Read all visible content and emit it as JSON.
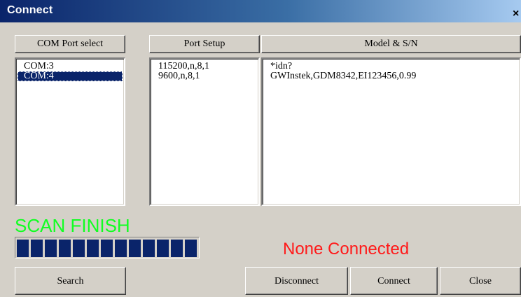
{
  "window": {
    "title": "Connect",
    "close_glyph": "×"
  },
  "columns": {
    "com_port": {
      "header": "COM Port select",
      "items": [
        {
          "label": "COM:3",
          "selected": false
        },
        {
          "label": "COM:4",
          "selected": true
        }
      ]
    },
    "port_setup": {
      "header": "Port Setup",
      "items": [
        "115200,n,8,1",
        "9600,n,8,1"
      ]
    },
    "model_sn": {
      "header": "Model & S/N",
      "lines": [
        "*idn?",
        "GWInstek,GDM8342,EI123456,0.99"
      ]
    }
  },
  "scan": {
    "status": "SCAN FINISH",
    "progress_fraction": 1.0,
    "segment_count": 13
  },
  "connection": {
    "status": "None Connected"
  },
  "buttons": {
    "search": "Search",
    "disconnect": "Disconnect",
    "connect": "Connect",
    "close": "Close"
  },
  "colors": {
    "scan_status": "#11ff22",
    "connection_status": "#ff1a1a",
    "progress_fill": "#0a246a",
    "selection": "#0a246a"
  }
}
